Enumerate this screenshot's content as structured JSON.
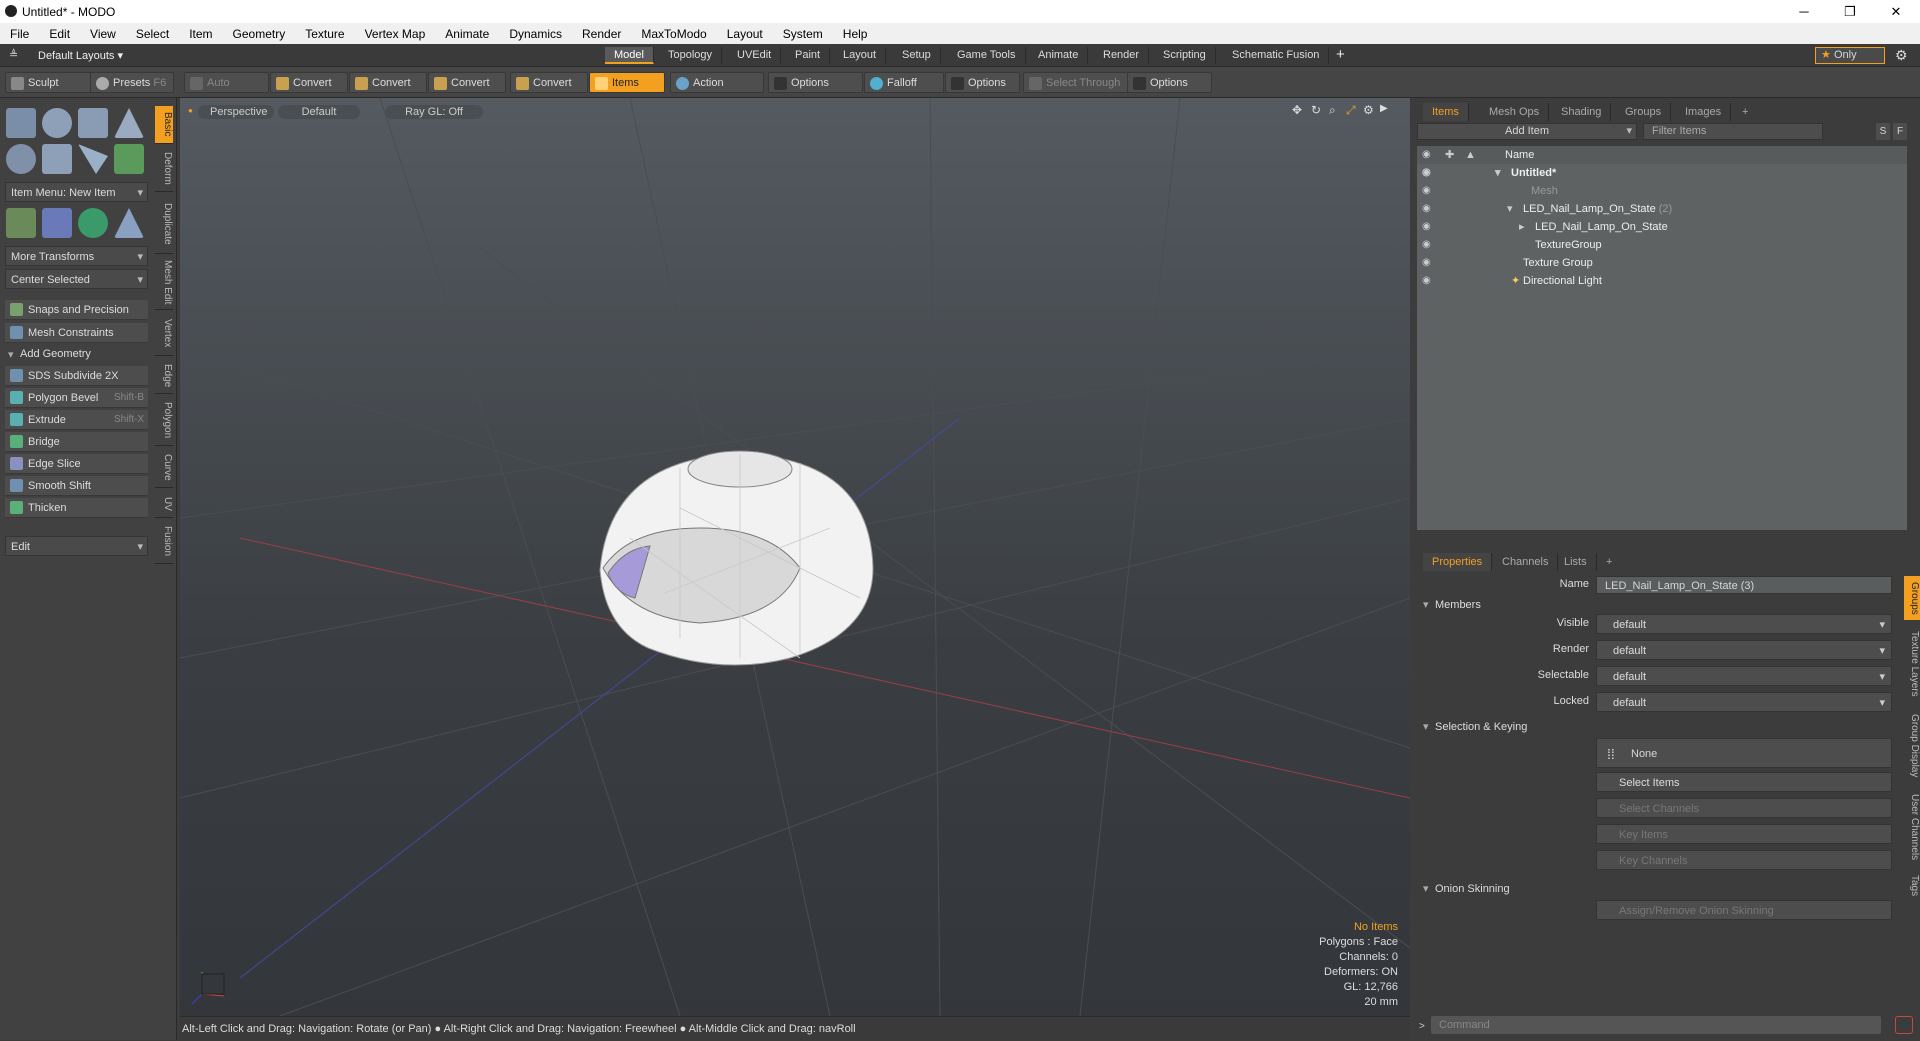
{
  "window": {
    "title": "Untitled* - MODO",
    "minimize": "─",
    "maximize": "❐",
    "close": "✕"
  },
  "menu": [
    "File",
    "Edit",
    "View",
    "Select",
    "Item",
    "Geometry",
    "Texture",
    "Vertex Map",
    "Animate",
    "Dynamics",
    "Render",
    "MaxToModo",
    "Layout",
    "System",
    "Help"
  ],
  "layoutbar": {
    "layout_dropdown": "Default Layouts",
    "tabs": [
      "Model",
      "Topology",
      "UVEdit",
      "Paint",
      "Layout",
      "Setup",
      "Game Tools",
      "Animate",
      "Render",
      "Scripting",
      "Schematic Fusion"
    ],
    "add": "+",
    "only": "Only"
  },
  "toolbar": {
    "sculpt": "Sculpt",
    "presets": "Presets",
    "presets_key": "F6",
    "auto_select": "Auto Select",
    "convert": "Convert",
    "items": "Items",
    "action_center": "Action Center",
    "options": "Options",
    "falloff": "Falloff",
    "select_through": "Select Through"
  },
  "left": {
    "item_menu": "Item Menu: New Item",
    "more_transforms": "More Transforms",
    "center_selected": "Center Selected",
    "snaps": "Snaps and Precision",
    "mesh_constraints": "Mesh Constraints",
    "add_geometry": "Add Geometry",
    "tools": [
      {
        "label": "SDS Subdivide 2X",
        "key": ""
      },
      {
        "label": "Polygon Bevel",
        "key": "Shift-B"
      },
      {
        "label": "Extrude",
        "key": "Shift-X"
      },
      {
        "label": "Bridge",
        "key": ""
      },
      {
        "label": "Edge Slice",
        "key": ""
      },
      {
        "label": "Smooth Shift",
        "key": ""
      },
      {
        "label": "Thicken",
        "key": ""
      }
    ],
    "edit": "Edit",
    "vtabs": [
      "Basic",
      "Deform",
      "Duplicate",
      "Mesh Edit",
      "Vertex",
      "Edge",
      "Polygon",
      "Curve",
      "UV",
      "Fusion"
    ]
  },
  "viewport": {
    "view": "Perspective",
    "shading": "Default",
    "raygl": "Ray GL: Off",
    "stats": [
      "No Items",
      "Polygons : Face",
      "Channels: 0",
      "Deformers: ON",
      "GL: 12,766",
      "20 mm"
    ]
  },
  "status": "Alt-Left Click and Drag: Navigation: Rotate (or Pan) ● Alt-Right Click and Drag: Navigation: Freewheel ● Alt-Middle Click and Drag: navRoll",
  "items_panel": {
    "tabs": [
      "Items",
      "Mesh Ops",
      "Shading",
      "Groups",
      "Images",
      "+"
    ],
    "add_item": "Add Item",
    "filter": "Filter Items",
    "col_name": "Name",
    "s": "S",
    "f": "F",
    "rows": [
      {
        "name": "Untitled*",
        "extra": ""
      },
      {
        "name": "Mesh",
        "extra": ""
      },
      {
        "name": "LED_Nail_Lamp_On_State",
        "extra": "(2)"
      },
      {
        "name": "LED_Nail_Lamp_On_State",
        "extra": ""
      },
      {
        "name": "TextureGroup",
        "extra": ""
      },
      {
        "name": "Texture Group",
        "extra": ""
      },
      {
        "name": "Directional Light",
        "extra": ""
      }
    ]
  },
  "props": {
    "tabs": [
      "Properties",
      "Channels",
      "Lists",
      "+"
    ],
    "name_label": "Name",
    "name_value": "LED_Nail_Lamp_On_State (3)",
    "members": "Members",
    "visible": "Visible",
    "render": "Render",
    "selectable": "Selectable",
    "locked": "Locked",
    "default": "default",
    "sel_keying": "Selection & Keying",
    "none": "None",
    "select_items": "Select Items",
    "select_channels": "Select Channels",
    "key_items": "Key Items",
    "key_channels": "Key Channels",
    "onion": "Onion Skinning",
    "assign_onion": "Assign/Remove Onion Skinning",
    "rvtabs": [
      "Groups",
      "Texture Layers",
      "Group Display",
      "User Channels",
      "Tags"
    ]
  },
  "command": "Command"
}
